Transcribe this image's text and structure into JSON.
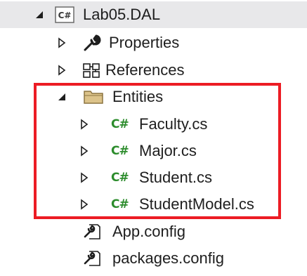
{
  "project": {
    "name": "Lab05.DAL",
    "icon": "csharp-project-icon"
  },
  "items": {
    "properties": {
      "label": "Properties",
      "icon": "wrench-icon"
    },
    "references": {
      "label": "References",
      "icon": "references-icon"
    },
    "entities": {
      "label": "Entities",
      "icon": "folder-icon"
    },
    "faculty": {
      "label": "Faculty.cs",
      "icon": "csharp-file-icon"
    },
    "major": {
      "label": "Major.cs",
      "icon": "csharp-file-icon"
    },
    "student": {
      "label": "Student.cs",
      "icon": "csharp-file-icon"
    },
    "studentmodel": {
      "label": "StudentModel.cs",
      "icon": "csharp-file-icon"
    },
    "appconfig": {
      "label": "App.config",
      "icon": "config-file-icon"
    },
    "packagesconfig": {
      "label": "packages.config",
      "icon": "config-file-icon"
    }
  },
  "csharp_glyph": "C#",
  "colors": {
    "selected_row": "#e8e8ea",
    "highlight_box": "#ec1c24",
    "csharp_green": "#2c8c2c",
    "folder": "#dcc38a"
  }
}
